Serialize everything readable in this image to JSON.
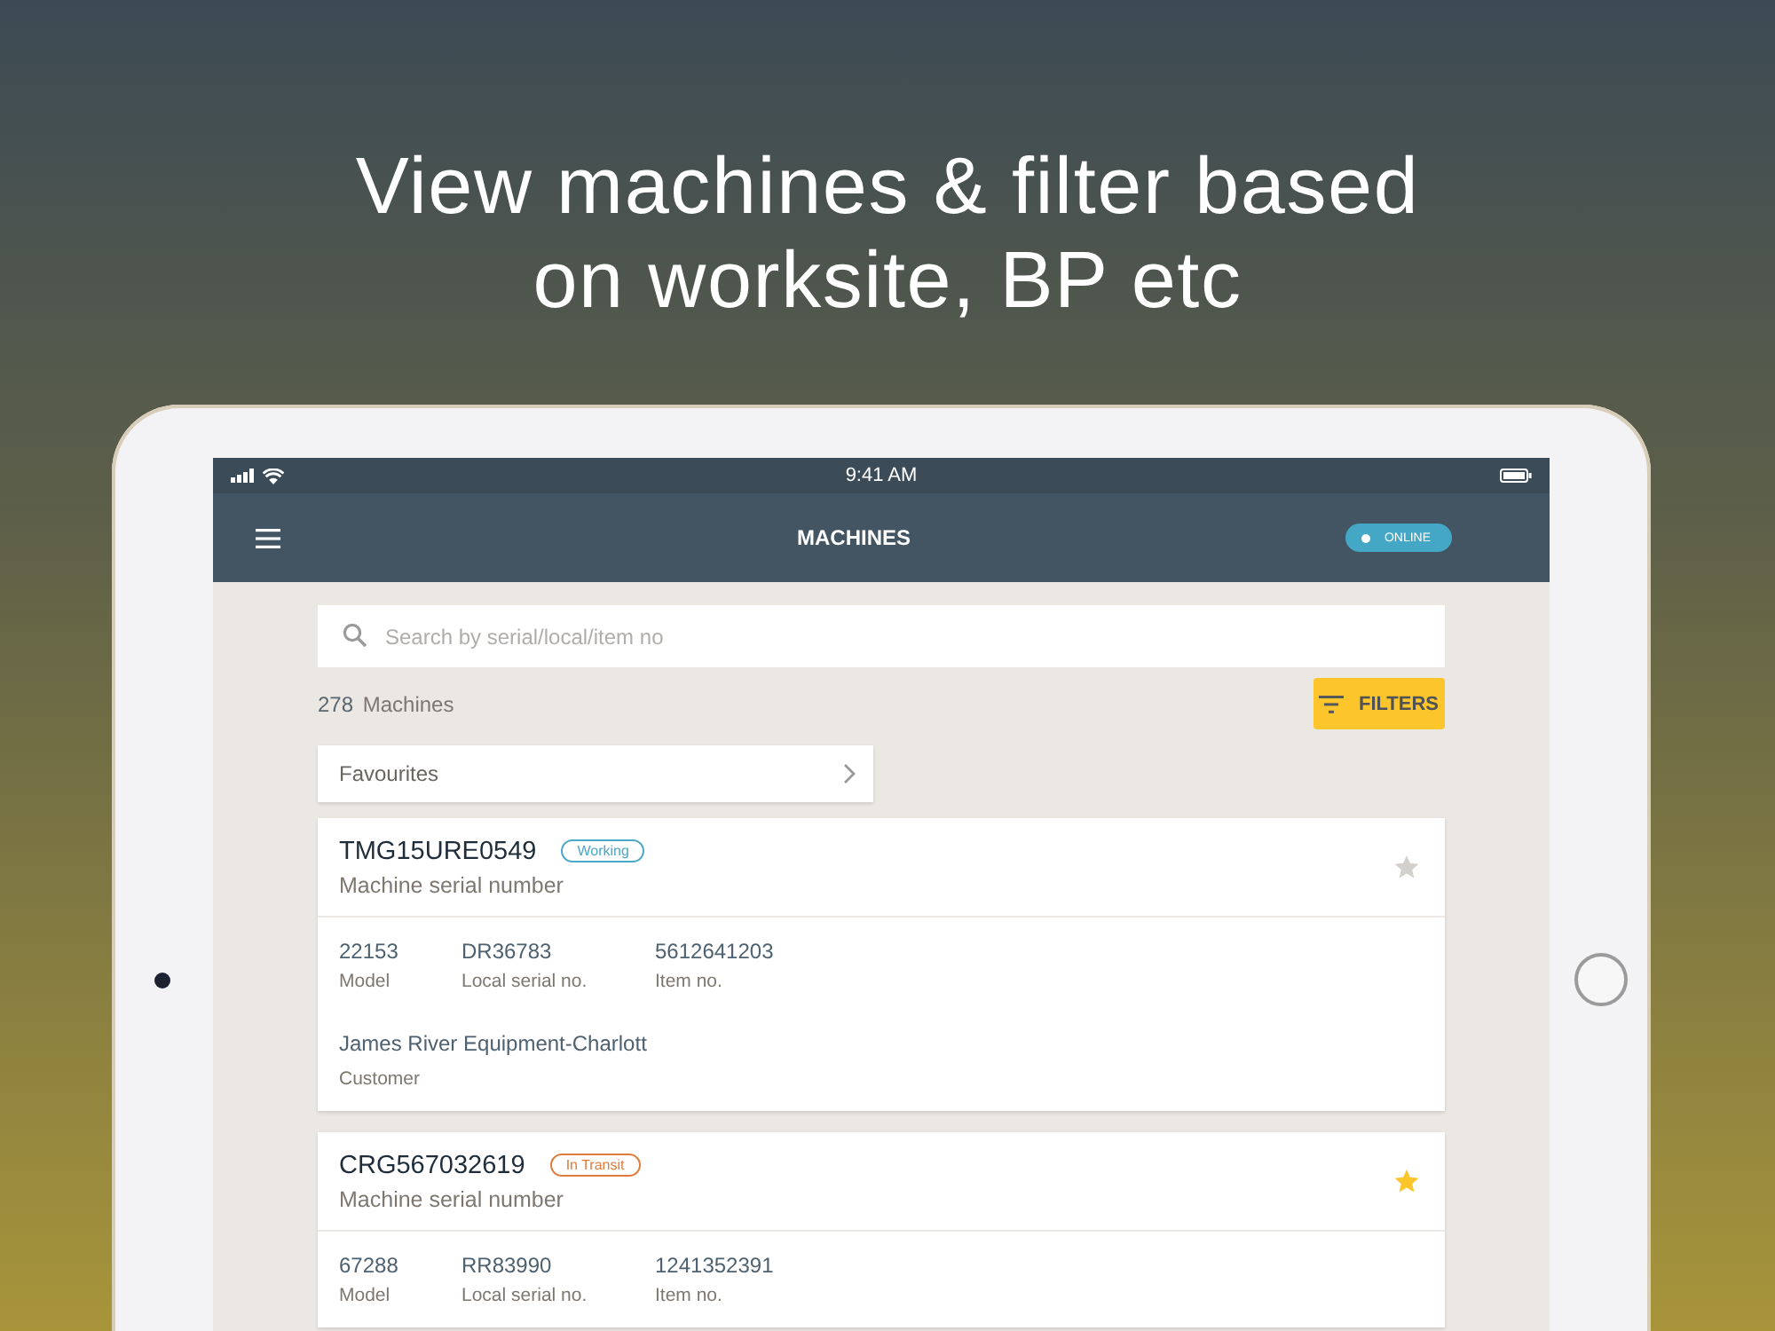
{
  "headline": [
    "View machines & filter based",
    "on worksite, BP etc"
  ],
  "status_bar": {
    "time": "9:41 AM"
  },
  "nav_bar": {
    "title": "MACHINES",
    "connection": {
      "label": "ONLINE",
      "online": true
    }
  },
  "search": {
    "placeholder": "Search by serial/local/item no"
  },
  "summary": {
    "count": "278",
    "label": "Machines"
  },
  "filters_button": "FILTERS",
  "favourites": {
    "label": "Favourites"
  },
  "machines": [
    {
      "serial": "TMG15URE0549",
      "serial_label": "Machine serial number",
      "status": {
        "label": "Working",
        "color": "#4aa8c8"
      },
      "favourite": false,
      "fields": [
        {
          "value": "22153",
          "label": "Model"
        },
        {
          "value": "DR36783",
          "label": "Local serial no."
        },
        {
          "value": "5612641203",
          "label": "Item no."
        }
      ],
      "customer": {
        "value": "James River Equipment-Charlott",
        "label": "Customer"
      }
    },
    {
      "serial": "CRG567032619",
      "serial_label": "Machine serial number",
      "status": {
        "label": "In Transit",
        "color": "#e07b3a"
      },
      "favourite": true,
      "fields": [
        {
          "value": "67288",
          "label": "Model"
        },
        {
          "value": "RR83990",
          "label": "Local serial no."
        },
        {
          "value": "1241352391",
          "label": "Item no."
        }
      ]
    }
  ]
}
